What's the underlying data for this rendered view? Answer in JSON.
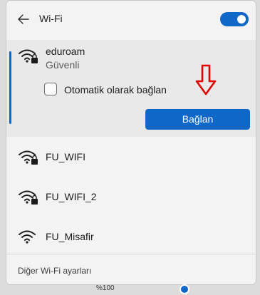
{
  "header": {
    "title": "Wi-Fi",
    "back_icon": "back-arrow-icon",
    "toggle_state": "on"
  },
  "expanded_network": {
    "name": "eduroam",
    "status": "Güvenli",
    "secured": true,
    "auto_connect_label": "Otomatik olarak bağlan",
    "auto_connect_checked": false,
    "connect_label": "Bağlan"
  },
  "networks": [
    {
      "name": "FU_WIFI",
      "secured": true
    },
    {
      "name": "FU_WIFI_2",
      "secured": true
    },
    {
      "name": "FU_Misafir",
      "secured": false
    }
  ],
  "footer": {
    "link_label": "Diğer Wi-Fi ayarları"
  },
  "taskbar": {
    "volume_text": "%100"
  },
  "colors": {
    "accent": "#0f67c8",
    "annotation_arrow": "#e00000"
  }
}
